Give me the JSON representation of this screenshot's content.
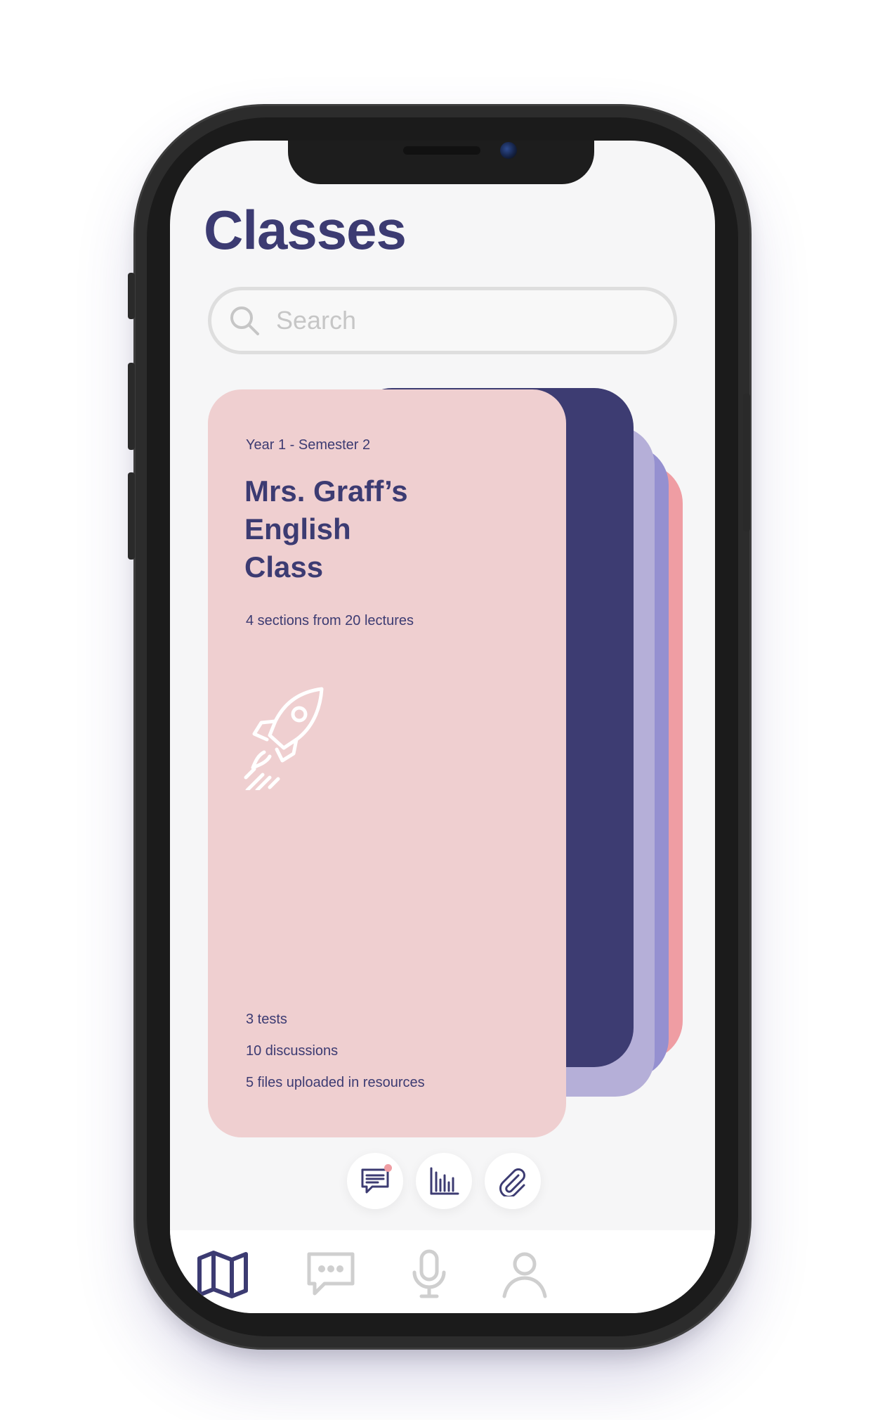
{
  "app": {
    "page_title": "Classes"
  },
  "search": {
    "placeholder": "Search",
    "value": ""
  },
  "class_card": {
    "meta": "Year 1 - Semester 2",
    "title": "Mrs. Graff’s\nEnglish\nClass",
    "sections": "4 sections from 20 lectures",
    "illustration_icon": "rocket-icon",
    "stats": [
      "3 tests",
      "10 discussions",
      "5 files uploaded in resources"
    ]
  },
  "stack_colors": [
    "#3d3c72",
    "#b5afd8",
    "#9590d0",
    "#ef9da3"
  ],
  "actions": [
    {
      "icon": "message-icon",
      "has_notification": true
    },
    {
      "icon": "bar-chart-icon",
      "has_notification": false
    },
    {
      "icon": "paperclip-icon",
      "has_notification": false
    }
  ],
  "tab_bar": [
    {
      "icon": "map-icon",
      "active": true
    },
    {
      "icon": "chat-icon",
      "active": false
    },
    {
      "icon": "microphone-icon",
      "active": false
    },
    {
      "icon": "profile-icon",
      "active": false
    }
  ],
  "colors": {
    "primary": "#3c3b72",
    "card_bg": "#efcfd0",
    "accent_pink": "#ef9da3",
    "inactive": "#cfcfcf"
  }
}
